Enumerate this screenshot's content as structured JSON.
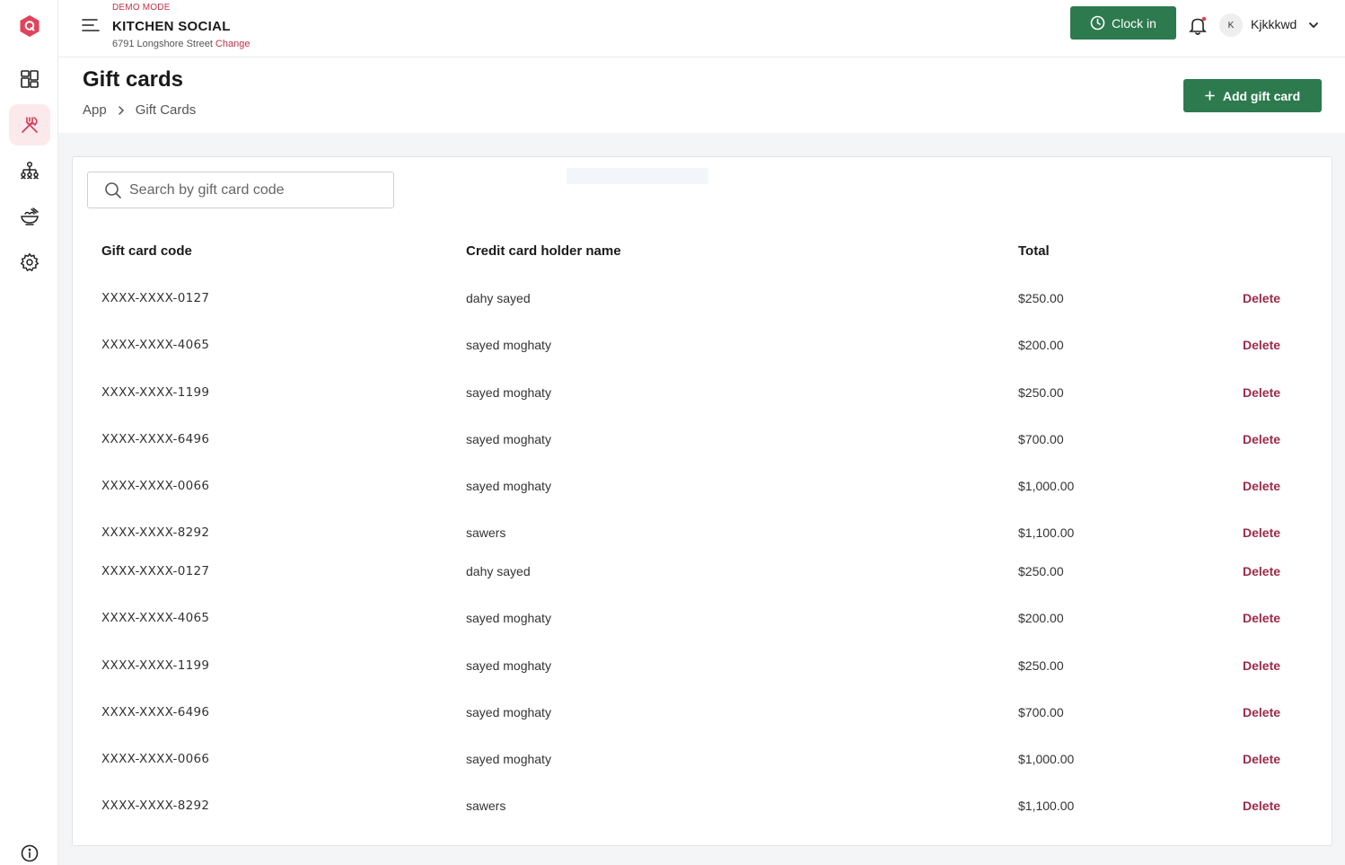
{
  "header": {
    "demo_mode": "DEMO MODE",
    "brand": "KITCHEN SOCIAL",
    "address": "6791 Longshore Street",
    "change_link": "Change",
    "clock_in_label": "Clock in",
    "user_initial": "K",
    "username": "Kjkkkwd"
  },
  "page": {
    "title": "Gift cards",
    "breadcrumb": [
      "App",
      "Gift Cards"
    ],
    "add_button_label": "Add gift card"
  },
  "search": {
    "placeholder": "Search by gift card code"
  },
  "table": {
    "columns": [
      "Gift card code",
      "Credit card holder name",
      "Total"
    ],
    "delete_label": "Delete",
    "rows": [
      {
        "code": "XXXX-XXXX-0127",
        "name": "dahy sayed",
        "total": "$250.00"
      },
      {
        "code": "XXXX-XXXX-4065",
        "name": "sayed moghaty",
        "total": "$200.00"
      },
      {
        "code": "XXXX-XXXX-1199",
        "name": "sayed moghaty",
        "total": "$250.00"
      },
      {
        "code": "XXXX-XXXX-6496",
        "name": "sayed moghaty",
        "total": "$700.00"
      },
      {
        "code": "XXXX-XXXX-0066",
        "name": "sayed moghaty",
        "total": "$1,000.00"
      },
      {
        "code": "XXXX-XXXX-8292",
        "name": "sawers",
        "total": "$1,100.00"
      },
      {
        "code": "XXXX-XXXX-0127",
        "name": "dahy sayed",
        "total": "$250.00"
      },
      {
        "code": "XXXX-XXXX-4065",
        "name": "sayed moghaty",
        "total": "$200.00"
      },
      {
        "code": "XXXX-XXXX-1199",
        "name": "sayed moghaty",
        "total": "$250.00"
      },
      {
        "code": "XXXX-XXXX-6496",
        "name": "sayed moghaty",
        "total": "$700.00"
      },
      {
        "code": "XXXX-XXXX-0066",
        "name": "sayed moghaty",
        "total": "$1,000.00"
      },
      {
        "code": "XXXX-XXXX-8292",
        "name": "sawers",
        "total": "$1,100.00"
      }
    ]
  },
  "sidebar": {
    "items": [
      {
        "icon": "dashboard-icon",
        "active": false
      },
      {
        "icon": "utensils-icon",
        "active": true
      },
      {
        "icon": "org-chart-icon",
        "active": false
      },
      {
        "icon": "food-bowl-icon",
        "active": false
      },
      {
        "icon": "gear-icon",
        "active": false
      }
    ],
    "footer_icon": "info-icon"
  },
  "colors": {
    "brand_green": "#2d7a4f",
    "accent_red": "#c0314a",
    "delete_red": "#9c2a4a",
    "active_bg": "#fbe9ec"
  }
}
